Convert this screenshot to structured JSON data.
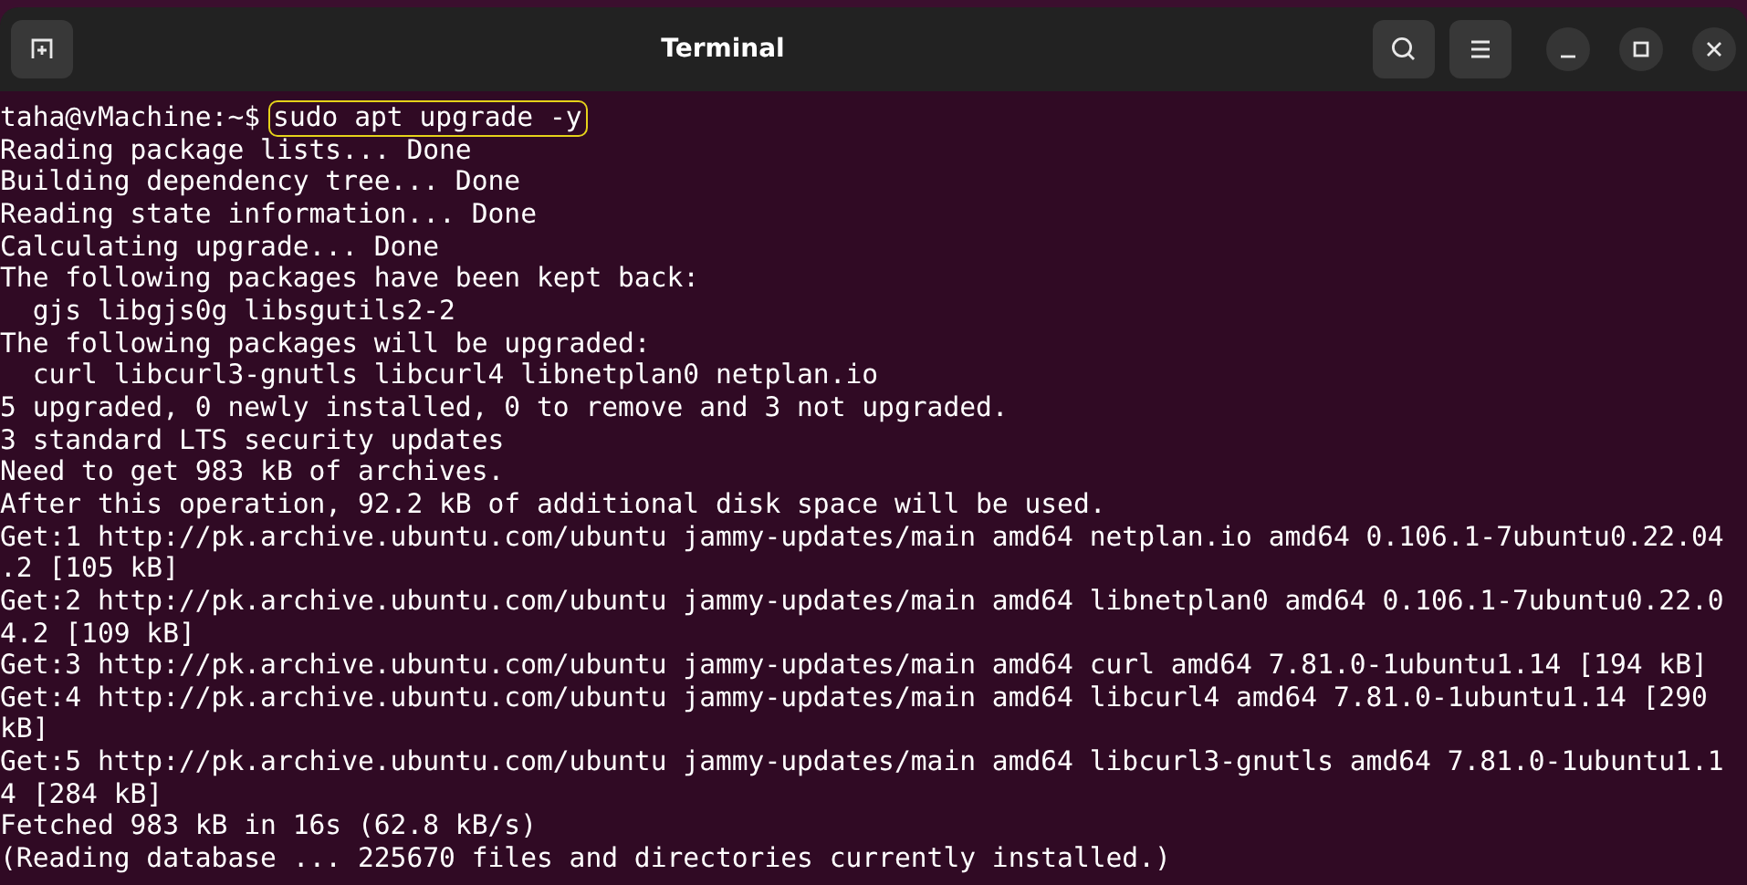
{
  "window": {
    "title": "Terminal"
  },
  "prompt": {
    "user_host": "taha@vMachine:~$",
    "command": "sudo apt upgrade -y",
    "highlighted": true
  },
  "output": [
    "Reading package lists... Done",
    "Building dependency tree... Done",
    "Reading state information... Done",
    "Calculating upgrade... Done",
    "The following packages have been kept back:",
    "  gjs libgjs0g libsgutils2-2",
    "The following packages will be upgraded:",
    "  curl libcurl3-gnutls libcurl4 libnetplan0 netplan.io",
    "5 upgraded, 0 newly installed, 0 to remove and 3 not upgraded.",
    "3 standard LTS security updates",
    "Need to get 983 kB of archives.",
    "After this operation, 92.2 kB of additional disk space will be used.",
    "Get:1 http://pk.archive.ubuntu.com/ubuntu jammy-updates/main amd64 netplan.io amd64 0.106.1-7ubuntu0.22.04",
    ".2 [105 kB]",
    "Get:2 http://pk.archive.ubuntu.com/ubuntu jammy-updates/main amd64 libnetplan0 amd64 0.106.1-7ubuntu0.22.0",
    "4.2 [109 kB]",
    "Get:3 http://pk.archive.ubuntu.com/ubuntu jammy-updates/main amd64 curl amd64 7.81.0-1ubuntu1.14 [194 kB]",
    "Get:4 http://pk.archive.ubuntu.com/ubuntu jammy-updates/main amd64 libcurl4 amd64 7.81.0-1ubuntu1.14 [290",
    "kB]",
    "Get:5 http://pk.archive.ubuntu.com/ubuntu jammy-updates/main amd64 libcurl3-gnutls amd64 7.81.0-1ubuntu1.1",
    "4 [284 kB]",
    "Fetched 983 kB in 16s (62.8 kB/s)",
    "(Reading database ... 225670 files and directories currently installed.)"
  ]
}
